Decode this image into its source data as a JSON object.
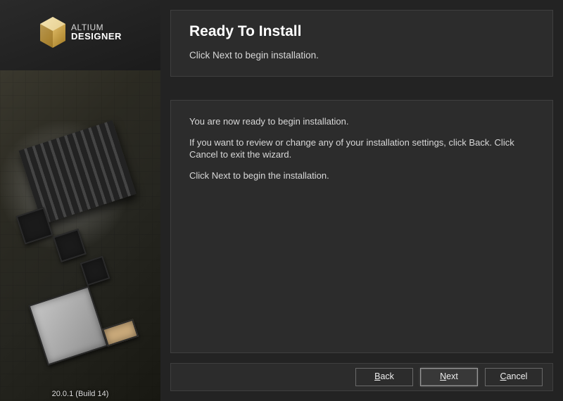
{
  "sidebar": {
    "brand_top": "ALTIUM",
    "brand_bot": "DESIGNER",
    "version": "20.0.1 (Build 14)"
  },
  "header": {
    "title": "Ready To Install",
    "subtitle": "Click Next to begin installation."
  },
  "body": {
    "p1": "You are now ready to begin installation.",
    "p2": "If you want to review or change any of your installation settings, click Back. Click Cancel to exit the wizard.",
    "p3": "Click Next to begin the installation."
  },
  "buttons": {
    "back": {
      "pre": "",
      "u": "B",
      "post": "ack"
    },
    "next": {
      "pre": "",
      "u": "N",
      "post": "ext"
    },
    "cancel": {
      "pre": "",
      "u": "C",
      "post": "ancel"
    }
  }
}
